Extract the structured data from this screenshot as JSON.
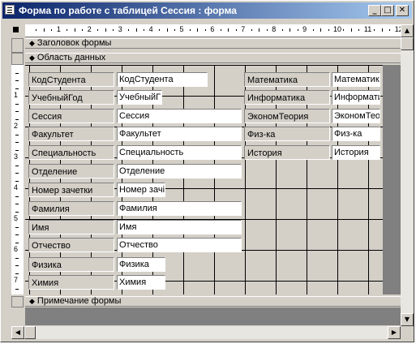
{
  "window": {
    "title": "Форма по работе с таблицей Сессия : форма",
    "min_glyph": "_",
    "max_glyph": "□",
    "close_glyph": "✕"
  },
  "ruler": {
    "h_numbers": [
      "1",
      "2",
      "3",
      "4",
      "5",
      "6",
      "7",
      "8",
      "9",
      "10",
      "11",
      "12"
    ],
    "v_numbers": [
      "1",
      "2",
      "3",
      "4",
      "5",
      "6",
      "7"
    ]
  },
  "sections": {
    "header": "Заголовок формы",
    "detail": "Область данных",
    "footer": "Примечание формы",
    "arrow_glyph": "◆"
  },
  "controls": {
    "left": [
      {
        "label": "КодСтудента",
        "field": "КодСтудента"
      },
      {
        "label": "УчебныйГод",
        "field": "УчебныйГ"
      },
      {
        "label": "Сессия",
        "field": "Сессия"
      },
      {
        "label": "Факультет",
        "field": "Факультет"
      },
      {
        "label": "Специальность",
        "field": "Специальность"
      },
      {
        "label": "Отделение",
        "field": "Отделение"
      },
      {
        "label": "Номер зачетки",
        "field": "Номер зачі"
      },
      {
        "label": "Фамилия",
        "field": "Фамилия"
      },
      {
        "label": "Имя",
        "field": "Имя"
      },
      {
        "label": "Отчество",
        "field": "Отчество"
      },
      {
        "label": "Физика",
        "field": "Физика"
      },
      {
        "label": "Химия",
        "field": "Химия"
      }
    ],
    "right": [
      {
        "label": "Математика",
        "field": "Математик"
      },
      {
        "label": "Информатика",
        "field": "Информати"
      },
      {
        "label": "ЭкономТеория",
        "field": "ЭкономТео"
      },
      {
        "label": "Физ-ка",
        "field": "Физ-ка"
      },
      {
        "label": "История",
        "field": "История"
      }
    ]
  },
  "scroll": {
    "left_glyph": "◀",
    "right_glyph": "▶",
    "up_glyph": "▲",
    "down_glyph": "▼"
  },
  "colors": {
    "titlebar_start": "#0a246a",
    "titlebar_end": "#a6caf0",
    "face": "#d4d0c8"
  }
}
